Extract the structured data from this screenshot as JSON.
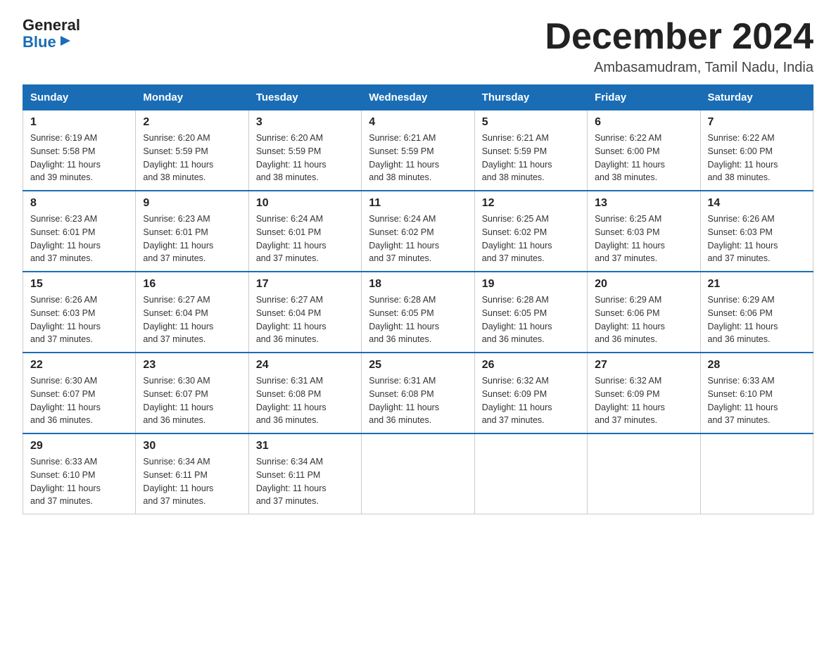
{
  "logo": {
    "general": "General",
    "blue": "Blue",
    "arrow": "▶"
  },
  "title": "December 2024",
  "location": "Ambasamudram, Tamil Nadu, India",
  "weekdays": [
    "Sunday",
    "Monday",
    "Tuesday",
    "Wednesday",
    "Thursday",
    "Friday",
    "Saturday"
  ],
  "weeks": [
    [
      {
        "day": "1",
        "sunrise": "6:19 AM",
        "sunset": "5:58 PM",
        "daylight": "11 hours and 39 minutes."
      },
      {
        "day": "2",
        "sunrise": "6:20 AM",
        "sunset": "5:59 PM",
        "daylight": "11 hours and 38 minutes."
      },
      {
        "day": "3",
        "sunrise": "6:20 AM",
        "sunset": "5:59 PM",
        "daylight": "11 hours and 38 minutes."
      },
      {
        "day": "4",
        "sunrise": "6:21 AM",
        "sunset": "5:59 PM",
        "daylight": "11 hours and 38 minutes."
      },
      {
        "day": "5",
        "sunrise": "6:21 AM",
        "sunset": "5:59 PM",
        "daylight": "11 hours and 38 minutes."
      },
      {
        "day": "6",
        "sunrise": "6:22 AM",
        "sunset": "6:00 PM",
        "daylight": "11 hours and 38 minutes."
      },
      {
        "day": "7",
        "sunrise": "6:22 AM",
        "sunset": "6:00 PM",
        "daylight": "11 hours and 38 minutes."
      }
    ],
    [
      {
        "day": "8",
        "sunrise": "6:23 AM",
        "sunset": "6:01 PM",
        "daylight": "11 hours and 37 minutes."
      },
      {
        "day": "9",
        "sunrise": "6:23 AM",
        "sunset": "6:01 PM",
        "daylight": "11 hours and 37 minutes."
      },
      {
        "day": "10",
        "sunrise": "6:24 AM",
        "sunset": "6:01 PM",
        "daylight": "11 hours and 37 minutes."
      },
      {
        "day": "11",
        "sunrise": "6:24 AM",
        "sunset": "6:02 PM",
        "daylight": "11 hours and 37 minutes."
      },
      {
        "day": "12",
        "sunrise": "6:25 AM",
        "sunset": "6:02 PM",
        "daylight": "11 hours and 37 minutes."
      },
      {
        "day": "13",
        "sunrise": "6:25 AM",
        "sunset": "6:03 PM",
        "daylight": "11 hours and 37 minutes."
      },
      {
        "day": "14",
        "sunrise": "6:26 AM",
        "sunset": "6:03 PM",
        "daylight": "11 hours and 37 minutes."
      }
    ],
    [
      {
        "day": "15",
        "sunrise": "6:26 AM",
        "sunset": "6:03 PM",
        "daylight": "11 hours and 37 minutes."
      },
      {
        "day": "16",
        "sunrise": "6:27 AM",
        "sunset": "6:04 PM",
        "daylight": "11 hours and 37 minutes."
      },
      {
        "day": "17",
        "sunrise": "6:27 AM",
        "sunset": "6:04 PM",
        "daylight": "11 hours and 36 minutes."
      },
      {
        "day": "18",
        "sunrise": "6:28 AM",
        "sunset": "6:05 PM",
        "daylight": "11 hours and 36 minutes."
      },
      {
        "day": "19",
        "sunrise": "6:28 AM",
        "sunset": "6:05 PM",
        "daylight": "11 hours and 36 minutes."
      },
      {
        "day": "20",
        "sunrise": "6:29 AM",
        "sunset": "6:06 PM",
        "daylight": "11 hours and 36 minutes."
      },
      {
        "day": "21",
        "sunrise": "6:29 AM",
        "sunset": "6:06 PM",
        "daylight": "11 hours and 36 minutes."
      }
    ],
    [
      {
        "day": "22",
        "sunrise": "6:30 AM",
        "sunset": "6:07 PM",
        "daylight": "11 hours and 36 minutes."
      },
      {
        "day": "23",
        "sunrise": "6:30 AM",
        "sunset": "6:07 PM",
        "daylight": "11 hours and 36 minutes."
      },
      {
        "day": "24",
        "sunrise": "6:31 AM",
        "sunset": "6:08 PM",
        "daylight": "11 hours and 36 minutes."
      },
      {
        "day": "25",
        "sunrise": "6:31 AM",
        "sunset": "6:08 PM",
        "daylight": "11 hours and 36 minutes."
      },
      {
        "day": "26",
        "sunrise": "6:32 AM",
        "sunset": "6:09 PM",
        "daylight": "11 hours and 37 minutes."
      },
      {
        "day": "27",
        "sunrise": "6:32 AM",
        "sunset": "6:09 PM",
        "daylight": "11 hours and 37 minutes."
      },
      {
        "day": "28",
        "sunrise": "6:33 AM",
        "sunset": "6:10 PM",
        "daylight": "11 hours and 37 minutes."
      }
    ],
    [
      {
        "day": "29",
        "sunrise": "6:33 AM",
        "sunset": "6:10 PM",
        "daylight": "11 hours and 37 minutes."
      },
      {
        "day": "30",
        "sunrise": "6:34 AM",
        "sunset": "6:11 PM",
        "daylight": "11 hours and 37 minutes."
      },
      {
        "day": "31",
        "sunrise": "6:34 AM",
        "sunset": "6:11 PM",
        "daylight": "11 hours and 37 minutes."
      },
      null,
      null,
      null,
      null
    ]
  ],
  "labels": {
    "sunrise": "Sunrise: ",
    "sunset": "Sunset: ",
    "daylight": "Daylight: "
  }
}
